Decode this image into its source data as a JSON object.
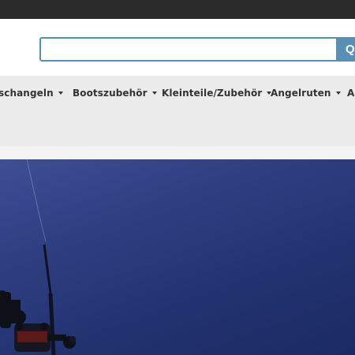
{
  "search": {
    "placeholder": "",
    "button_label": "Q"
  },
  "nav": {
    "items": [
      {
        "label": "schangeln"
      },
      {
        "label": "Bootszubehör"
      },
      {
        "label": "Kleinteile/Zubehör"
      },
      {
        "label": "Angelruten"
      },
      {
        "label": "A"
      }
    ]
  },
  "colors": {
    "topbar": "#2b2b2b",
    "accent": "#5a8fb4",
    "nav_bg": "#ececec",
    "hero_blue": "#2a3a7c"
  }
}
